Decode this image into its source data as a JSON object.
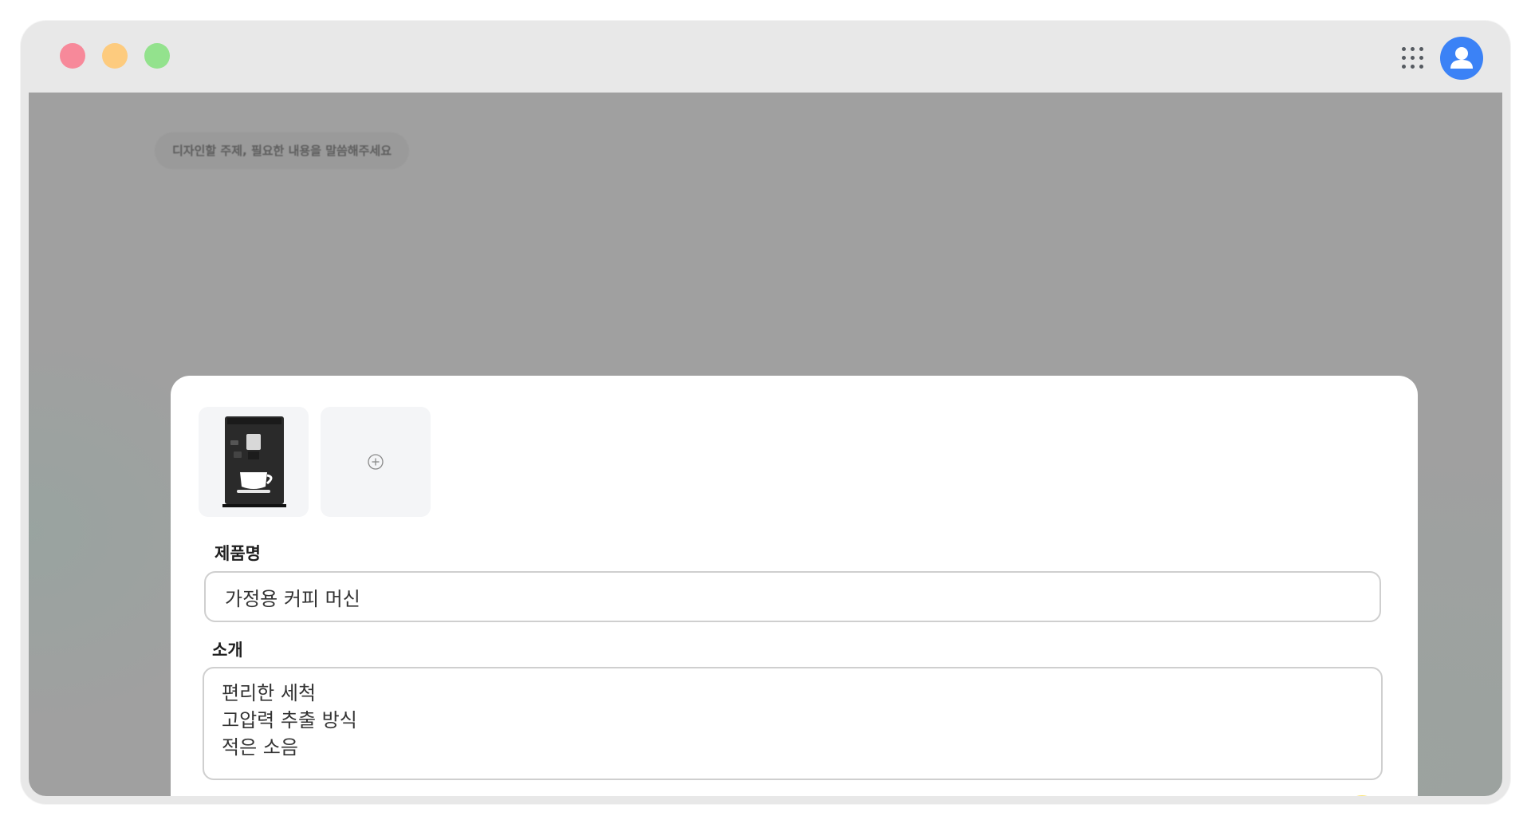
{
  "window": {
    "traffic_lights": [
      {
        "name": "close",
        "color": "#f7899a"
      },
      {
        "name": "minimize",
        "color": "#fdcb7e"
      },
      {
        "name": "maximize",
        "color": "#93e28d"
      }
    ],
    "header": {
      "apps_icon": "apps-grid-icon",
      "avatar_icon": "user-avatar-icon",
      "avatar_color": "#3b82f6"
    }
  },
  "background": {
    "prompt_placeholder": "디자인할 주제, 필요한 내용을 말씀해주세요"
  },
  "form": {
    "images": [
      {
        "kind": "uploaded",
        "icon": "coffee-machine-image"
      },
      {
        "kind": "add",
        "icon": "plus-circle-icon"
      }
    ],
    "product_name_label": "제품명",
    "product_name_value": "가정용 커피 머신",
    "intro_label": "소개",
    "intro_lines": [
      "편리한 세척",
      "고압력 추출 방식",
      "적은 소음"
    ],
    "submit_icon": "arrow-up-icon",
    "submit_color": "#fbe36a"
  }
}
